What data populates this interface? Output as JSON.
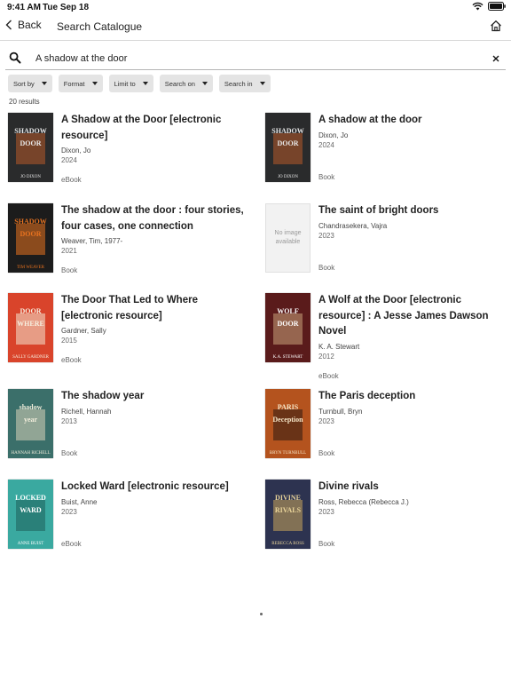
{
  "status": {
    "time": "9:41 AM",
    "date": "Tue Sep 18"
  },
  "nav": {
    "back_label": "Back",
    "title": "Search Catalogue"
  },
  "search": {
    "value": "A shadow at the door"
  },
  "filters": [
    "Sort by",
    "Format",
    "Limit to",
    "Search on",
    "Search in"
  ],
  "results_count": "20 results",
  "results": [
    {
      "title": "A Shadow at the Door [electronic resource]",
      "author": "Dixon, Jo",
      "year": "2024",
      "format": "eBook",
      "cover": {
        "bg": "#2a2b2c",
        "accent": "#b65a2a",
        "text": "#e8e8e8",
        "line1": "SHADOW",
        "line2": "DOOR",
        "byline": "JO DIXON"
      }
    },
    {
      "title": "A shadow at the door",
      "author": "Dixon, Jo",
      "year": "2024",
      "format": "Book",
      "cover": {
        "bg": "#2a2b2c",
        "accent": "#b65a2a",
        "text": "#e8e8e8",
        "line1": "SHADOW",
        "line2": "DOOR",
        "byline": "JO DIXON"
      }
    },
    {
      "title": "The shadow at the door : four stories, four cases, one connection",
      "author": "Weaver, Tim, 1977-",
      "year": "2021",
      "format": "Book",
      "cover": {
        "bg": "#1c1c1c",
        "accent": "#e8721f",
        "text": "#e8721f",
        "line1": "SHADOW",
        "line2": "DOOR",
        "byline": "TIM WEAVER"
      }
    },
    {
      "title": "The saint of bright doors",
      "author": "Chandrasekera, Vajra",
      "year": "2023",
      "format": "Book",
      "cover": {
        "no_image": "No image available"
      }
    },
    {
      "title": "The Door That Led to Where [electronic resource]",
      "author": "Gardner, Sally",
      "year": "2015",
      "format": "eBook",
      "cover": {
        "bg": "#d9442b",
        "accent": "#f2e6d0",
        "text": "#f7efe0",
        "line1": "DOOR",
        "line2": "WHERE",
        "byline": "SALLY GARDNER"
      }
    },
    {
      "title": "A Wolf at the Door [electronic resource] : A Jesse James Dawson Novel",
      "author": "K. A. Stewart",
      "year": "2012",
      "format": "eBook",
      "cover": {
        "bg": "#5a1b1b",
        "accent": "#c9a27a",
        "text": "#ffffff",
        "line1": "WOLF",
        "line2": "DOOR",
        "byline": "K.A. STEWART"
      }
    },
    {
      "title": "The shadow year",
      "author": "Richell, Hannah",
      "year": "2013",
      "format": "Book",
      "cover": {
        "bg": "#3b6f6a",
        "accent": "#d8d2b8",
        "text": "#f2eedc",
        "line1": "shadow",
        "line2": "year",
        "byline": "HANNAH RICHELL"
      }
    },
    {
      "title": "The Paris deception",
      "author": "Turnbull, Bryn",
      "year": "2023",
      "format": "Book",
      "cover": {
        "bg": "#b4531e",
        "accent": "#2b1a12",
        "text": "#f6e6c8",
        "line1": "PARIS",
        "line2": "Deception",
        "byline": "BRYN TURNBULL"
      }
    },
    {
      "title": "Locked Ward [electronic resource]",
      "author": "Buist, Anne",
      "year": "2023",
      "format": "eBook",
      "cover": {
        "bg": "#3aa9a0",
        "accent": "#1d5f5a",
        "text": "#ffffff",
        "line1": "LOCKED",
        "line2": "WARD",
        "byline": "ANNE BUIST"
      }
    },
    {
      "title": "Divine rivals",
      "author": "Ross, Rebecca (Rebecca J.)",
      "year": "2023",
      "format": "Book",
      "cover": {
        "bg": "#2d3350",
        "accent": "#c9a45a",
        "text": "#e9d49a",
        "line1": "DIVINE",
        "line2": "RIVALS",
        "byline": "REBECCA ROSS"
      }
    }
  ],
  "colors": {
    "chip_bg": "#e4e4e4",
    "divider": "#d8d8d8"
  },
  "icons": {
    "back": "chevron-left-icon",
    "home": "home-icon",
    "search": "search-icon",
    "clear": "close-icon"
  }
}
